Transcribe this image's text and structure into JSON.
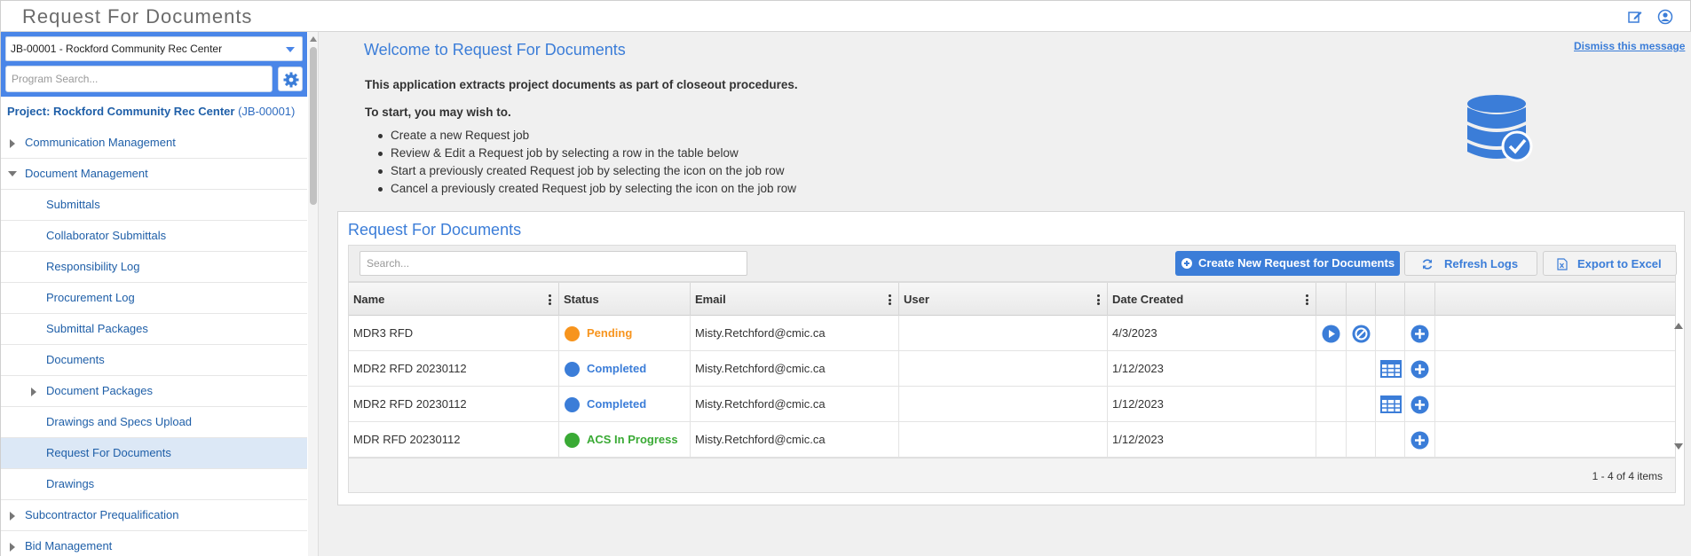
{
  "app": {
    "title": "Request For Documents"
  },
  "sidebar": {
    "job_selected": "JB-00001 - Rockford Community Rec Center",
    "search_placeholder": "Program Search...",
    "project_label": "Project: Rockford Community Rec Center",
    "project_code": "(JB-00001)",
    "items": [
      {
        "label": "Communication Management",
        "level": 0,
        "expander": "collapsed"
      },
      {
        "label": "Document Management",
        "level": 0,
        "expander": "expanded"
      },
      {
        "label": "Submittals",
        "level": 1
      },
      {
        "label": "Collaborator Submittals",
        "level": 1
      },
      {
        "label": "Responsibility Log",
        "level": 1
      },
      {
        "label": "Procurement Log",
        "level": 1
      },
      {
        "label": "Submittal Packages",
        "level": 1
      },
      {
        "label": "Documents",
        "level": 1
      },
      {
        "label": "Document Packages",
        "level": 1,
        "expander": "collapsed"
      },
      {
        "label": "Drawings and Specs Upload",
        "level": 1
      },
      {
        "label": "Request For Documents",
        "level": 1,
        "active": true
      },
      {
        "label": "Drawings",
        "level": 1
      },
      {
        "label": "Subcontractor Prequalification",
        "level": 0,
        "expander": "collapsed"
      },
      {
        "label": "Bid Management",
        "level": 0,
        "expander": "collapsed"
      }
    ]
  },
  "welcome": {
    "title": "Welcome to Request For Documents",
    "dismiss": "Dismiss this message",
    "intro": "This application extracts project documents as part of closeout procedures.",
    "start": "To start, you may wish to.",
    "bullets": [
      "Create a new Request job",
      "Review & Edit a Request job by selecting a row in the table below",
      "Start a previously created Request job by selecting the icon on the job row",
      "Cancel a previously created Request job by selecting the icon on the job row"
    ]
  },
  "panel": {
    "title": "Request For Documents",
    "search_placeholder": "Search...",
    "create_label": "Create New Request for Documents",
    "refresh_label": "Refresh Logs",
    "export_label": "Export to Excel",
    "columns": [
      "Name",
      "Status",
      "Email",
      "User",
      "Date Created"
    ],
    "rows": [
      {
        "name": "MDR3 RFD",
        "status": "Pending",
        "status_color": "#f7941d",
        "email": "Misty.Retchford@cmic.ca",
        "user": "",
        "date": "4/3/2023",
        "actions": [
          "play-icon",
          "cancel-icon",
          "",
          "add-icon"
        ]
      },
      {
        "name": "MDR2 RFD 20230112",
        "status": "Completed",
        "status_color": "#3b7dd8",
        "email": "Misty.Retchford@cmic.ca",
        "user": "",
        "date": "1/12/2023",
        "actions": [
          "",
          "",
          "table-icon",
          "add-icon"
        ]
      },
      {
        "name": "MDR2 RFD 20230112",
        "status": "Completed",
        "status_color": "#3b7dd8",
        "email": "Misty.Retchford@cmic.ca",
        "user": "",
        "date": "1/12/2023",
        "actions": [
          "",
          "",
          "table-icon",
          "add-icon"
        ]
      },
      {
        "name": "MDR RFD 20230112",
        "status": "ACS In Progress",
        "status_color": "#3aaa35",
        "email": "Misty.Retchford@cmic.ca",
        "user": "",
        "date": "1/12/2023",
        "actions": [
          "",
          "",
          "",
          "add-icon"
        ]
      }
    ],
    "pager": "1 - 4 of 4 items"
  },
  "colors": {
    "accent": "#3b7dd8",
    "sidebar_head": "#4a86e8",
    "active_row": "#dce8f6"
  }
}
